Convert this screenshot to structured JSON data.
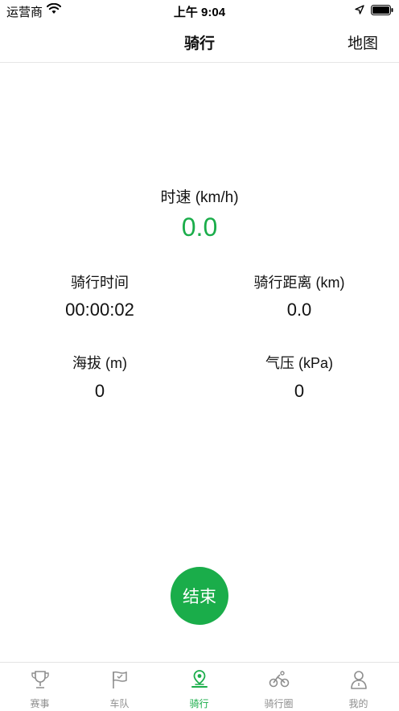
{
  "status_bar": {
    "carrier": "运营商",
    "time": "上午 9:04"
  },
  "nav": {
    "title": "骑行",
    "right_action": "地图"
  },
  "speed": {
    "label": "时速 (km/h)",
    "value": "0.0",
    "accent_color": "#1aad4a"
  },
  "stats": {
    "riding_time": {
      "label": "骑行时间",
      "value": "00:00:02"
    },
    "distance": {
      "label": "骑行距离 (km)",
      "value": "0.0"
    },
    "altitude": {
      "label": "海拔 (m)",
      "value": "0"
    },
    "pressure": {
      "label": "气压 (kPa)",
      "value": "0"
    }
  },
  "end_button": {
    "label": "结束"
  },
  "tabs": [
    {
      "label": "赛事",
      "icon": "trophy-icon",
      "active": false
    },
    {
      "label": "车队",
      "icon": "flag-icon",
      "active": false
    },
    {
      "label": "骑行",
      "icon": "location-pin-icon",
      "active": true
    },
    {
      "label": "骑行圈",
      "icon": "bicycle-icon",
      "active": false
    },
    {
      "label": "我的",
      "icon": "person-icon",
      "active": false
    }
  ]
}
